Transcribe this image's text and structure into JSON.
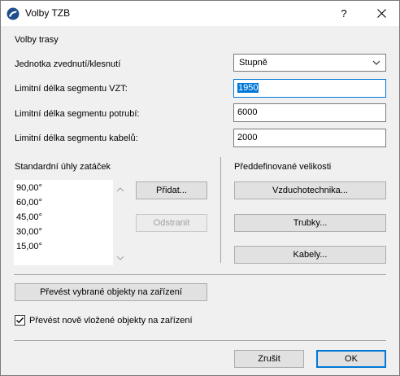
{
  "window": {
    "title": "Volby TZB",
    "help": "?"
  },
  "icons": {
    "app": "app-logo-icon",
    "close": "close-icon",
    "dropdown": "chevron-down-icon",
    "check": "check-icon"
  },
  "section_route": {
    "heading": "Volby trasy"
  },
  "fields": {
    "elevation_unit": {
      "label": "Jednotka zvednutí/klesnutí",
      "value": "Stupně"
    },
    "hvac_segment": {
      "label": "Limitní délka segmentu VZT:",
      "value": "1950"
    },
    "pipe_segment": {
      "label": "Limitní délka segmentu potrubí:",
      "value": "6000"
    },
    "cable_segment": {
      "label": "Limitní délka segmentu kabelů:",
      "value": "2000"
    }
  },
  "angles": {
    "heading": "Standardní úhly zatáček",
    "items": [
      "90,00°",
      "60,00°",
      "45,00°",
      "30,00°",
      "15,00°"
    ],
    "add": "Přidat...",
    "remove": "Odstranit"
  },
  "sizes": {
    "heading": "Předdefinované velikosti",
    "hvac": "Vzduchotechnika...",
    "pipes": "Trubky...",
    "cables": "Kabely..."
  },
  "convert_selected": "Převést vybrané objekty na zařízení",
  "convert_new": {
    "label": "Převést nově vložené objekty na zařízení",
    "checked": true
  },
  "footer": {
    "cancel": "Zrušit",
    "ok": "OK"
  }
}
